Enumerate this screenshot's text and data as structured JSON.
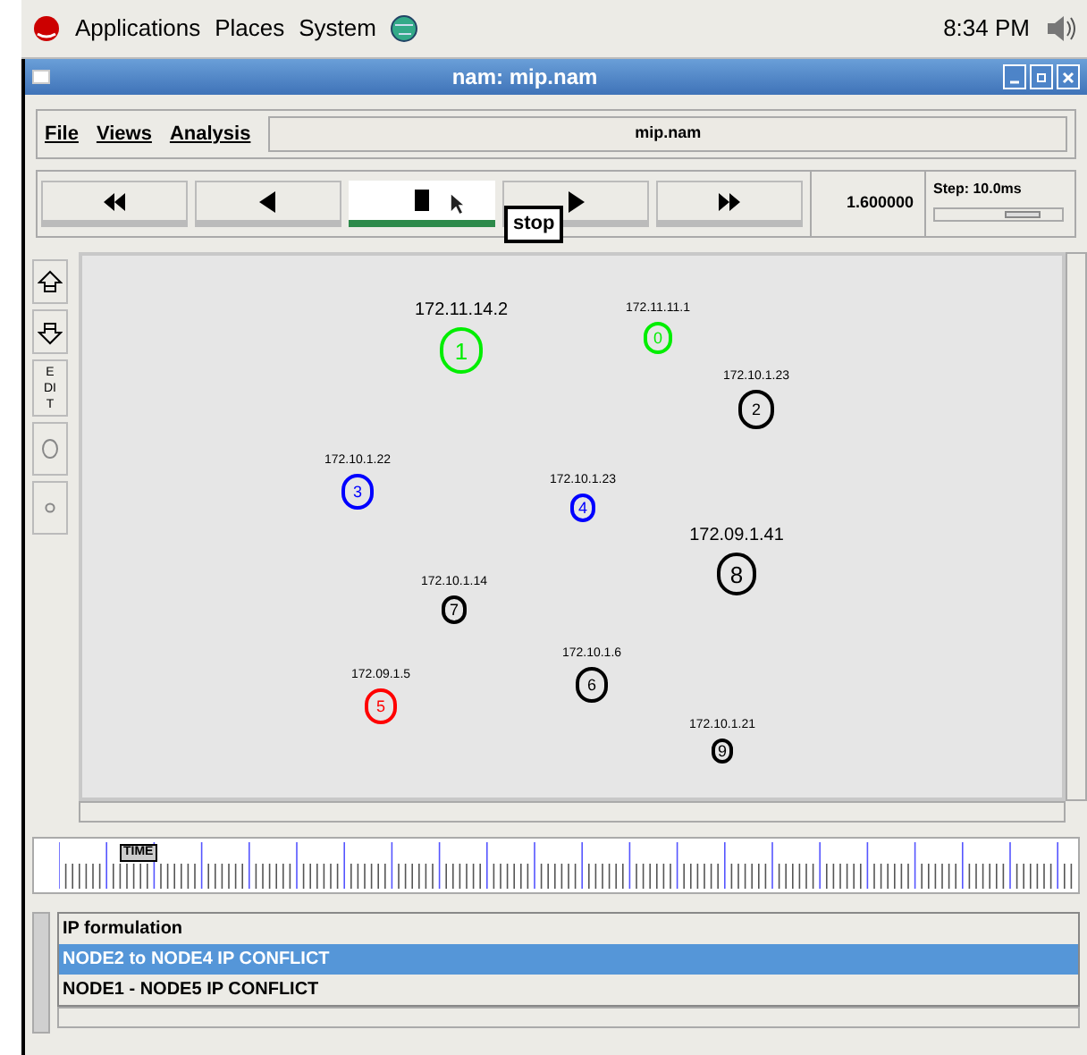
{
  "panel": {
    "menus": [
      "Applications",
      "Places",
      "System"
    ],
    "clock": "8:34 PM"
  },
  "window": {
    "title": "nam: mip.nam"
  },
  "menubar": {
    "items": [
      "File",
      "Views",
      "Analysis"
    ],
    "file_label": "mip.nam"
  },
  "transport": {
    "buttons": [
      {
        "kind": "rewind",
        "selected": false
      },
      {
        "kind": "back",
        "selected": false
      },
      {
        "kind": "stop",
        "selected": true
      },
      {
        "kind": "play",
        "selected": false
      },
      {
        "kind": "forward",
        "selected": false
      }
    ],
    "tooltip": "stop",
    "time": "1.600000",
    "step": {
      "label": "Step: 10.0ms",
      "level": 0.75
    }
  },
  "tools": [
    {
      "kind": "zoom-in"
    },
    {
      "kind": "zoom-out"
    },
    {
      "kind": "edit",
      "text": "EDIT"
    },
    {
      "kind": "big-circle"
    },
    {
      "kind": "small-circle"
    }
  ],
  "nodes": [
    {
      "id": "1",
      "label": "172.11.14.2",
      "color": "#00ee00"
    },
    {
      "id": "0",
      "label": "172.11.11.1",
      "color": "#00ee00"
    },
    {
      "id": "2",
      "label": "172.10.1.23",
      "color": "#000000"
    },
    {
      "id": "3",
      "label": "172.10.1.22",
      "color": "#0000ff"
    },
    {
      "id": "4",
      "label": "172.10.1.23",
      "color": "#0000ff"
    },
    {
      "id": "8",
      "label": "172.09.1.41",
      "color": "#000000"
    },
    {
      "id": "7",
      "label": "172.10.1.14",
      "color": "#000000"
    },
    {
      "id": "5",
      "label": "172.09.1.5",
      "color": "#ff0000"
    },
    {
      "id": "6",
      "label": "172.10.1.6",
      "color": "#000000"
    },
    {
      "id": "9",
      "label": "172.10.1.21",
      "color": "#000000"
    }
  ],
  "timeline": {
    "marker": "TIME"
  },
  "annotations": [
    {
      "text": "IP formulation",
      "selected": false
    },
    {
      "text": "NODE2 to NODE4 IP CONFLICT",
      "selected": true
    },
    {
      "text": "NODE1 - NODE5 IP CONFLICT",
      "selected": false
    }
  ]
}
